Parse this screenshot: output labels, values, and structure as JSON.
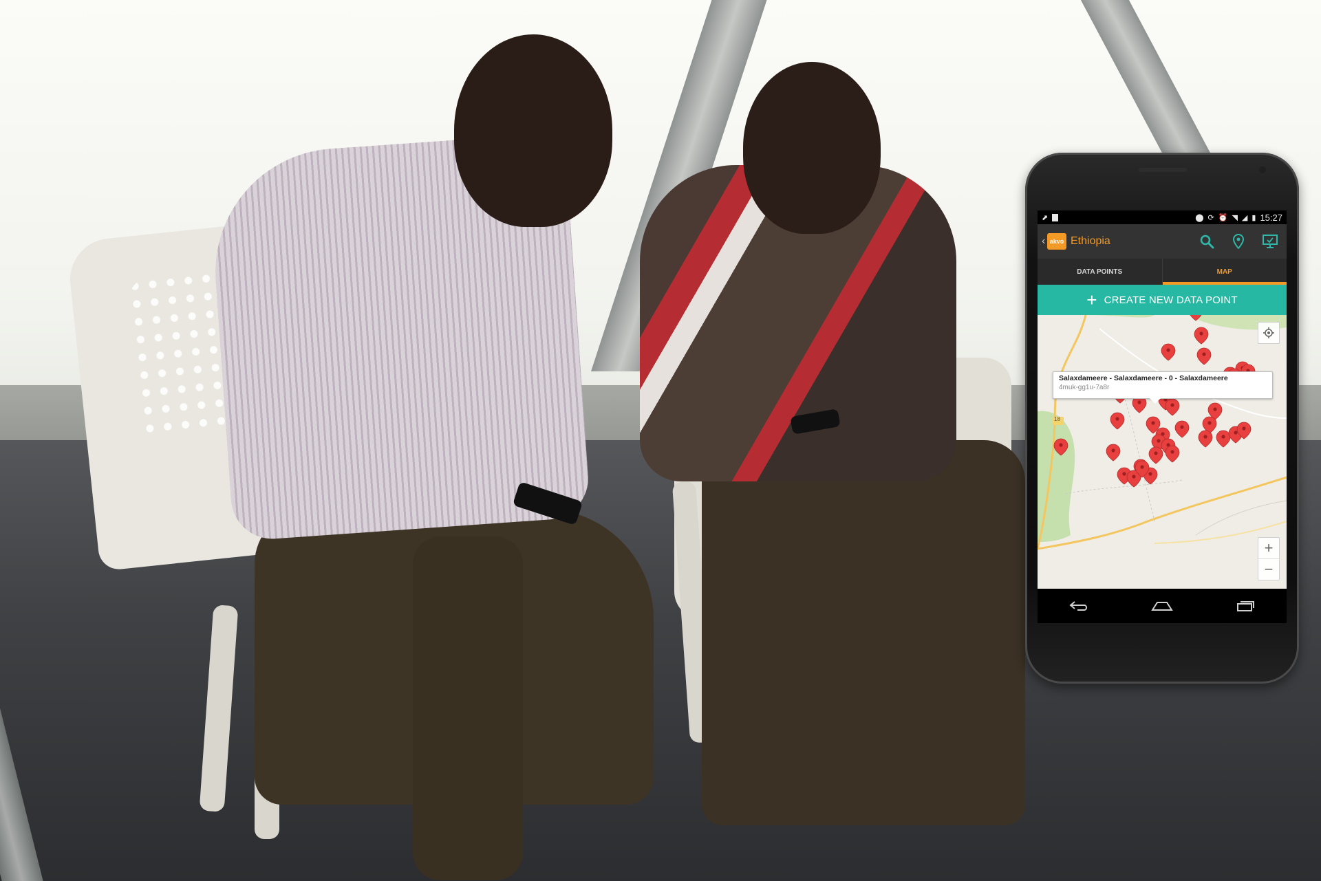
{
  "statusbar": {
    "time": "15:27"
  },
  "actionbar": {
    "logo_text": "akvo",
    "title": "Ethiopia"
  },
  "tabs": [
    {
      "label": "DATA POINTS",
      "active": false
    },
    {
      "label": "MAP",
      "active": true
    }
  ],
  "create_button": {
    "label": "CREATE NEW DATA POINT"
  },
  "map": {
    "callout": {
      "title": "Salaxdameere - Salaxdameere - 0 - Salaxdameere",
      "subtitle": "4muk-gg1u-7a8r"
    },
    "road_badge": "18",
    "pin_count": 34
  },
  "colors": {
    "accent_orange": "#f39a26",
    "create_teal": "#27b8a3",
    "pin_red": "#e8403f",
    "action_icon_teal": "#2fb8a9"
  },
  "icons": {
    "search": "search-icon",
    "place": "location-pin-icon",
    "sync": "monitor-sync-icon",
    "locate": "my-location-icon",
    "back": "nav-back-icon",
    "home": "nav-home-icon",
    "recents": "nav-recents-icon"
  }
}
